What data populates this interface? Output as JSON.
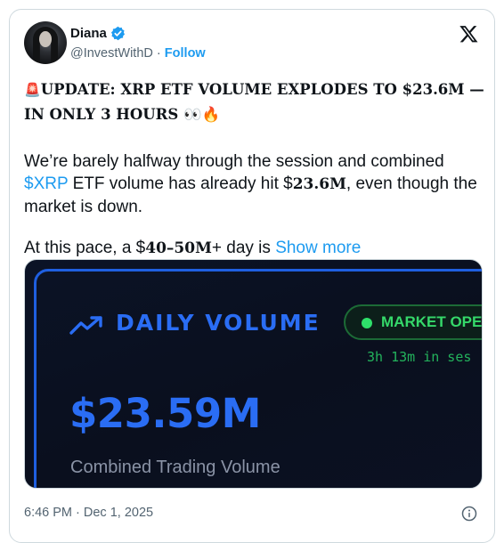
{
  "author": {
    "name": "Diana",
    "handle": "@InvestWithD",
    "separator": "·",
    "follow_label": "Follow",
    "verified": true,
    "avatar": "profile-photo"
  },
  "platform_logo": "x-logo-icon",
  "headline": {
    "siren_emoji": "🚨",
    "text": "UPDATE: XRP ETF VOLUME EXPLODES TO $23.6M — IN ONLY 3 HOURS",
    "trailing_emojis": "👀🔥"
  },
  "body": {
    "p1_a": "We’re barely halfway through the session and combined ",
    "p1_cashtag": "$XRP",
    "p1_b": " ETF volume has already hit $",
    "p1_amount": "23.6M",
    "p1_c": ", even though the market is down.",
    "p2_a": "At this pace, a $",
    "p2_range": "40–50M",
    "p2_b": "+ day is ",
    "show_more": "Show more"
  },
  "media": {
    "title": "DAILY VOLUME",
    "status": "MARKET OPEN",
    "status_truncated": "MARKET OPE",
    "session_time": "3h 13m in ses",
    "value": "$23.59M",
    "caption": "Combined Trading Volume",
    "colors": {
      "accent": "#2a6df4",
      "status_green": "#35d96a",
      "background": "#0b1326"
    }
  },
  "footer": {
    "timestamp": "6:46 PM · Dec 1, 2025",
    "info_icon": "info-icon"
  }
}
